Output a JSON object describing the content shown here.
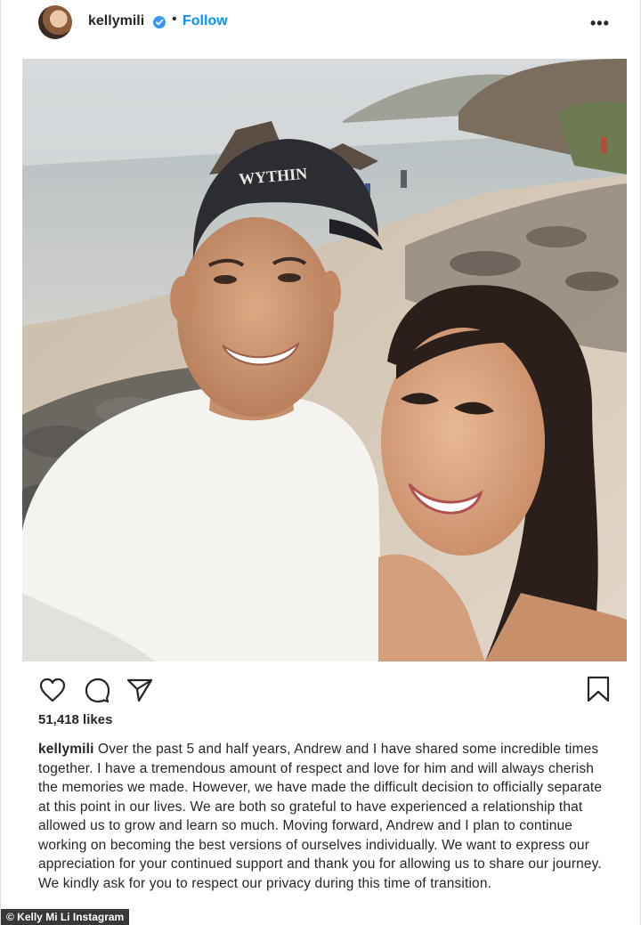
{
  "post": {
    "username": "kellymili",
    "verified": true,
    "separator": "•",
    "follow_label": "Follow",
    "more_label": "•••",
    "likes": "51,418 likes",
    "caption_user": "kellymili",
    "caption_text": "Over the past 5 and half years, Andrew and I have shared some incredible times together. I have a tremendous amount of respect and love for him and will always cherish the memories we made. However, we have made the difficult decision to officially separate at this point in our lives. We are both so grateful to have experienced a relationship that allowed us to grow and learn so much. Moving forward, Andrew and I plan to continue working on becoming the best versions of ourselves individually. We want to express our appreciation for your continued support and thank you for allowing us to share our journey. We kindly ask for you to respect our privacy during this time of transition.",
    "photo": {
      "cap_text": "WYTHIN"
    }
  },
  "icons": {
    "like": "heart-icon",
    "comment": "comment-icon",
    "share": "paper-plane-icon",
    "save": "bookmark-icon",
    "verified": "verified-badge-icon"
  },
  "credit": "© Kelly Mi Li Instagram",
  "colors": {
    "link": "#0095f6",
    "verified": "#3897f0",
    "text": "#262626"
  }
}
